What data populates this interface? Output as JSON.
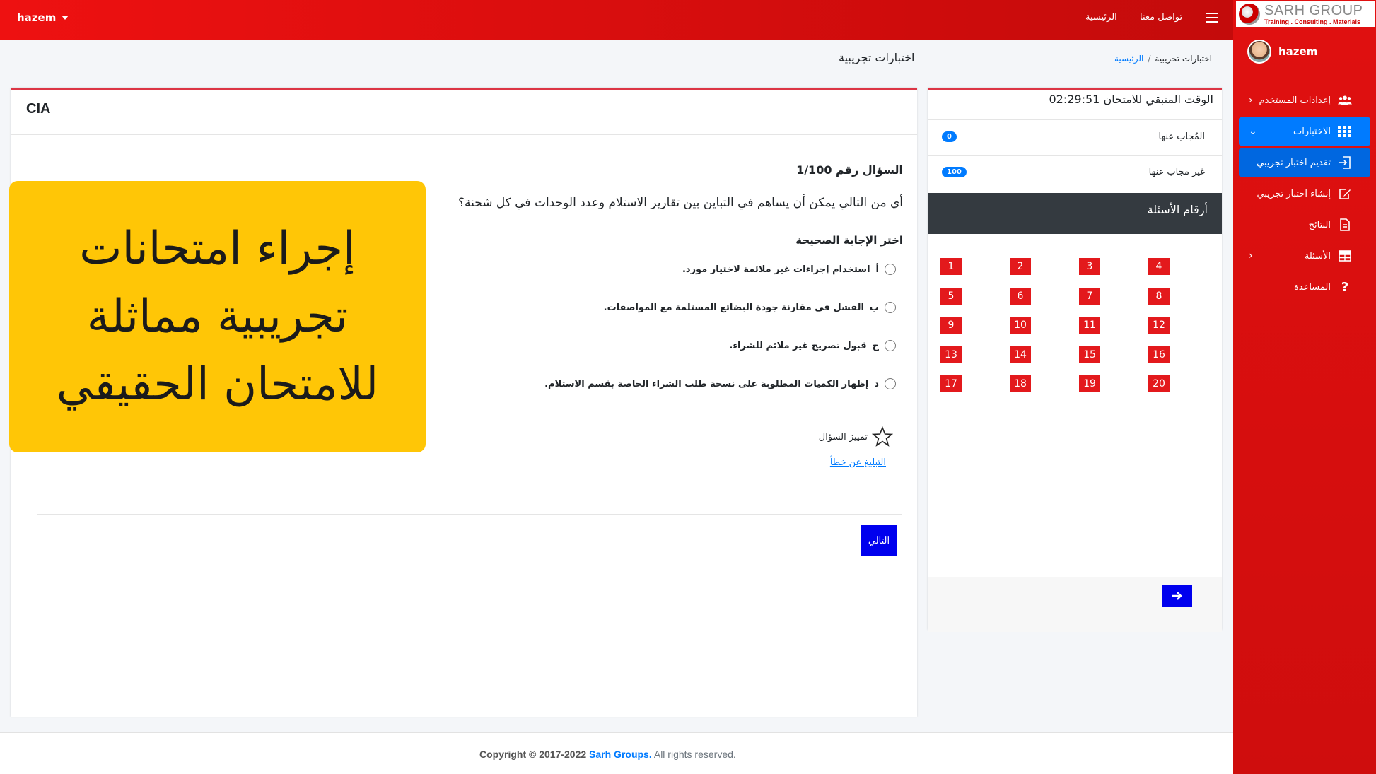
{
  "topbar": {
    "user": "hazem",
    "nav_home": "الرئيسية",
    "nav_contact": "تواصل معنا"
  },
  "sidebar": {
    "brand_name": "SARH GROUP",
    "brand_tagline": "Training . Consulting . Materials",
    "user": "hazem",
    "items": [
      {
        "label": "إعدادات المستخدم",
        "icon": "users-icon"
      },
      {
        "label": "الاختبارات",
        "icon": "th-icon"
      },
      {
        "label": "تقديم اختبار تجريبي",
        "icon": "sign-in-icon"
      },
      {
        "label": "إنشاء اختبار تجريبي",
        "icon": "edit-icon"
      },
      {
        "label": "النتائج",
        "icon": "file-icon"
      },
      {
        "label": "الأسئلة",
        "icon": "table-icon"
      },
      {
        "label": "المساعدة",
        "icon": "question-icon"
      }
    ]
  },
  "header": {
    "page_title": "اختبارات تجريبية",
    "breadcrumb_home": "الرئيسية",
    "breadcrumb_sep": "/",
    "breadcrumb_current": "اختبارات تجريبية"
  },
  "exam": {
    "title": "CIA",
    "question_number": "السؤال رقم 1/100",
    "question_text": "أي من التالي يمكن أن يساهم في التباين بين تقارير الاستلام وعدد الوحدات في كل شحنة؟",
    "choose_label": "اختر الإجابة الصحيحة",
    "options": [
      {
        "letter": "أ",
        "text": "استخدام إجراءات غير ملائمة لاختيار مورد."
      },
      {
        "letter": "ب",
        "text": "الفشل في مقارنة جودة البضائع المستلمة مع المواصفات."
      },
      {
        "letter": "ج",
        "text": "قبول تصريح غير ملائم للشراء."
      },
      {
        "letter": "د",
        "text": "إظهار الكميات المطلوبة على نسخة طلب الشراء الخاصة بقسم الاستلام."
      }
    ],
    "flag_label": "تمييز السؤال",
    "report_label": "التبليغ عن خطأ",
    "next_label": "التالي"
  },
  "promo": {
    "text": "إجراء امتحانات\nتجريبية مماثلة\nللامتحان الحقيقي",
    "color": "#ffc606"
  },
  "side": {
    "timer": "الوقت المتبقي للامتحان 02:29:51",
    "answered_label": "المُجاب عنها",
    "answered_count": "0",
    "unanswered_label": "غير مجاب عنها",
    "unanswered_count": "100",
    "qnums_title": "أرقام الأسئلة",
    "numbers": [
      "1",
      "2",
      "3",
      "4",
      "5",
      "6",
      "7",
      "8",
      "9",
      "10",
      "11",
      "12",
      "13",
      "14",
      "15",
      "16",
      "17",
      "18",
      "19",
      "20"
    ],
    "arrow_icon": "arrow-right-icon"
  },
  "footer": {
    "copyright": "Copyright © 2017-2022",
    "brand": "Sarh Groups.",
    "rights": "All rights reserved."
  },
  "colors": {
    "brand_red": "#e01010",
    "accent_blue": "#007bff",
    "button_blue": "#0000ee",
    "qbox_red": "#e3191c"
  }
}
